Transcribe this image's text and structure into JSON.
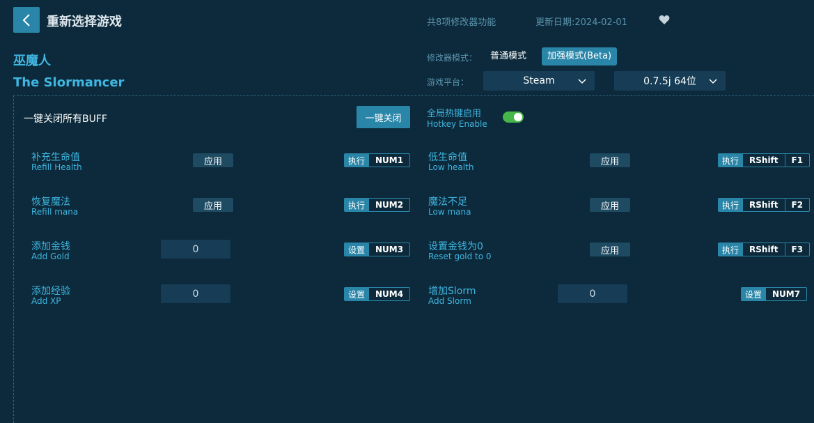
{
  "header": {
    "title": "重新选择游戏",
    "feature_count": "共8项修改器功能",
    "update_date": "更新日期:2024-02-01"
  },
  "game": {
    "name_cn": "巫魔人",
    "name_en": "The Slormancer"
  },
  "settings": {
    "mode_label": "修改器模式：",
    "mode_normal": "普通模式",
    "mode_beta": "加强模式(Beta)",
    "platform_label": "游戏平台：",
    "platform_value": "Steam",
    "version_value": "0.7.5j 64位"
  },
  "global": {
    "close_all_label": "一键关闭所有BUFF",
    "close_all_button": "一键关闭",
    "hotkey_cn": "全局热键启用",
    "hotkey_en": "Hotkey Enable",
    "hotkey_enabled": true
  },
  "features": {
    "f1": {
      "cn": "补充生命值",
      "en": "Refill Health",
      "ctrl": "应用",
      "act": "执行",
      "keys": [
        "NUM1"
      ]
    },
    "f2": {
      "cn": "恢复魔法",
      "en": "Refill mana",
      "ctrl": "应用",
      "act": "执行",
      "keys": [
        "NUM2"
      ]
    },
    "f3": {
      "cn": "添加金钱",
      "en": "Add Gold",
      "value": "0",
      "act": "设置",
      "keys": [
        "NUM3"
      ]
    },
    "f4": {
      "cn": "添加经验",
      "en": "Add XP",
      "value": "0",
      "act": "设置",
      "keys": [
        "NUM4"
      ]
    },
    "f5": {
      "cn": "低生命值",
      "en": "Low health",
      "ctrl": "应用",
      "act": "执行",
      "keys": [
        "RShift",
        "F1"
      ]
    },
    "f6": {
      "cn": "魔法不足",
      "en": "Low mana",
      "ctrl": "应用",
      "act": "执行",
      "keys": [
        "RShift",
        "F2"
      ]
    },
    "f7": {
      "cn": "设置金钱为0",
      "en": "Reset gold to 0",
      "ctrl": "应用",
      "act": "执行",
      "keys": [
        "RShift",
        "F3"
      ]
    },
    "f8": {
      "cn": "增加Slorm",
      "en": "Add Slorm",
      "value": "0",
      "act": "设置",
      "keys": [
        "NUM7"
      ]
    }
  },
  "colors": {
    "background": "#0c2a3b",
    "accent": "#2a86a8",
    "label_blue": "#3fb6e1",
    "toggle_on": "#47b64a"
  }
}
